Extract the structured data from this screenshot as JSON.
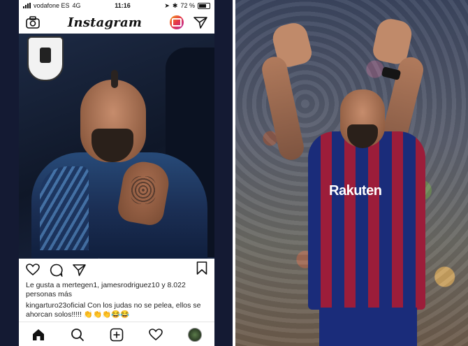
{
  "status_bar": {
    "carrier": "vodafone ES",
    "network": "4G",
    "time": "11:16",
    "battery": "72 %"
  },
  "header": {
    "title": "Instagram"
  },
  "post": {
    "likes_text": "Le gusta a mertegen1, jamesrodriguez10 y 8.022 personas más",
    "comment_user": "kingarturo23oficial",
    "comment_text": "Con los judas no se pelea, ellos se ahorcan solos!!!!! 👏👏👏😂😂"
  },
  "right_photo": {
    "shirt_sponsor": "Rakuten"
  },
  "icons": {
    "camera": "camera-icon",
    "igtv": "igtv-icon",
    "direct": "direct-message-icon",
    "like": "heart-icon",
    "comment": "comment-icon",
    "share": "share-icon",
    "save": "bookmark-icon",
    "home": "home-icon",
    "search": "search-icon",
    "add": "add-post-icon",
    "activity": "heart-icon",
    "profile": "profile-avatar"
  },
  "colors": {
    "background_left": "#141a33",
    "igtv_gradient": "#e4364a"
  }
}
